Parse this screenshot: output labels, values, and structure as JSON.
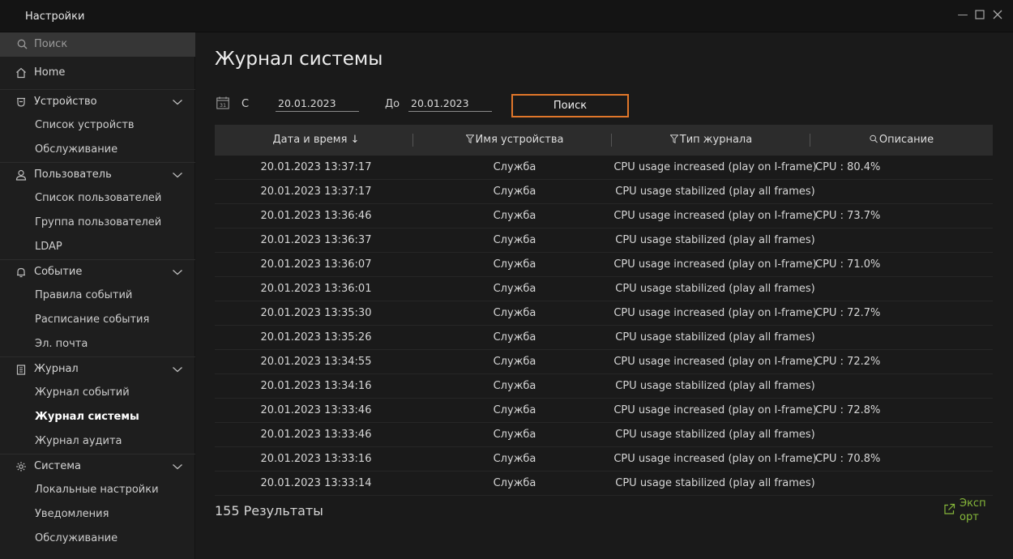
{
  "window": {
    "title": "Настройки",
    "controls": [
      "minimize",
      "maximize",
      "close"
    ]
  },
  "sidebar": {
    "search_placeholder": "Поиск",
    "home": "Home",
    "groups": [
      {
        "label": "Устройство",
        "icon": "device-icon",
        "items": [
          "Список устройств",
          "Обслуживание"
        ]
      },
      {
        "label": "Пользователь",
        "icon": "user-icon",
        "items": [
          "Список пользователей",
          "Группа пользователей",
          "LDAP"
        ]
      },
      {
        "label": "Событие",
        "icon": "bell-icon",
        "items": [
          "Правила событий",
          "Расписание события",
          "Эл. почта"
        ]
      },
      {
        "label": "Журнал",
        "icon": "clipboard-icon",
        "items": [
          "Журнал событий",
          "Журнал системы",
          "Журнал аудита"
        ]
      },
      {
        "label": "Система",
        "icon": "gear-icon",
        "items": [
          "Локальные настройки",
          "Уведомления",
          "Обслуживание"
        ]
      }
    ],
    "active_item": "Журнал системы"
  },
  "main": {
    "title": "Журнал системы",
    "filter": {
      "calendar_icon_text": "31",
      "from_label": "С",
      "from_value": "20.01.2023",
      "to_label": "До",
      "to_value": "20.01.2023",
      "search_button": "Поиск"
    },
    "table": {
      "columns": [
        "Дата и время ↓",
        "Имя устройства",
        "Тип журнала",
        "Описание"
      ],
      "rows": [
        [
          "20.01.2023 13:37:17",
          "Служба",
          "CPU usage increased (play on I-frame)",
          "CPU : 80.4%"
        ],
        [
          "20.01.2023 13:37:17",
          "Служба",
          "CPU usage stabilized (play all frames)",
          ""
        ],
        [
          "20.01.2023 13:36:46",
          "Служба",
          "CPU usage increased (play on I-frame)",
          "CPU : 73.7%"
        ],
        [
          "20.01.2023 13:36:37",
          "Служба",
          "CPU usage stabilized (play all frames)",
          ""
        ],
        [
          "20.01.2023 13:36:07",
          "Служба",
          "CPU usage increased (play on I-frame)",
          "CPU : 71.0%"
        ],
        [
          "20.01.2023 13:36:01",
          "Служба",
          "CPU usage stabilized (play all frames)",
          ""
        ],
        [
          "20.01.2023 13:35:30",
          "Служба",
          "CPU usage increased (play on I-frame)",
          "CPU : 72.7%"
        ],
        [
          "20.01.2023 13:35:26",
          "Служба",
          "CPU usage stabilized (play all frames)",
          ""
        ],
        [
          "20.01.2023 13:34:55",
          "Служба",
          "CPU usage increased (play on I-frame)",
          "CPU : 72.2%"
        ],
        [
          "20.01.2023 13:34:16",
          "Служба",
          "CPU usage stabilized (play all frames)",
          ""
        ],
        [
          "20.01.2023 13:33:46",
          "Служба",
          "CPU usage increased (play on I-frame)",
          "CPU : 72.8%"
        ],
        [
          "20.01.2023 13:33:46",
          "Служба",
          "CPU usage stabilized (play all frames)",
          ""
        ],
        [
          "20.01.2023 13:33:16",
          "Служба",
          "CPU usage increased (play on I-frame)",
          "CPU : 70.8%"
        ],
        [
          "20.01.2023 13:33:14",
          "Служба",
          "CPU usage stabilized (play all frames)",
          ""
        ]
      ]
    },
    "results_text": "155 Результаты",
    "export_label": "Экспорт"
  },
  "colors": {
    "accent": "#e0762a",
    "export": "#86b83a",
    "active_bg": "#363636"
  }
}
